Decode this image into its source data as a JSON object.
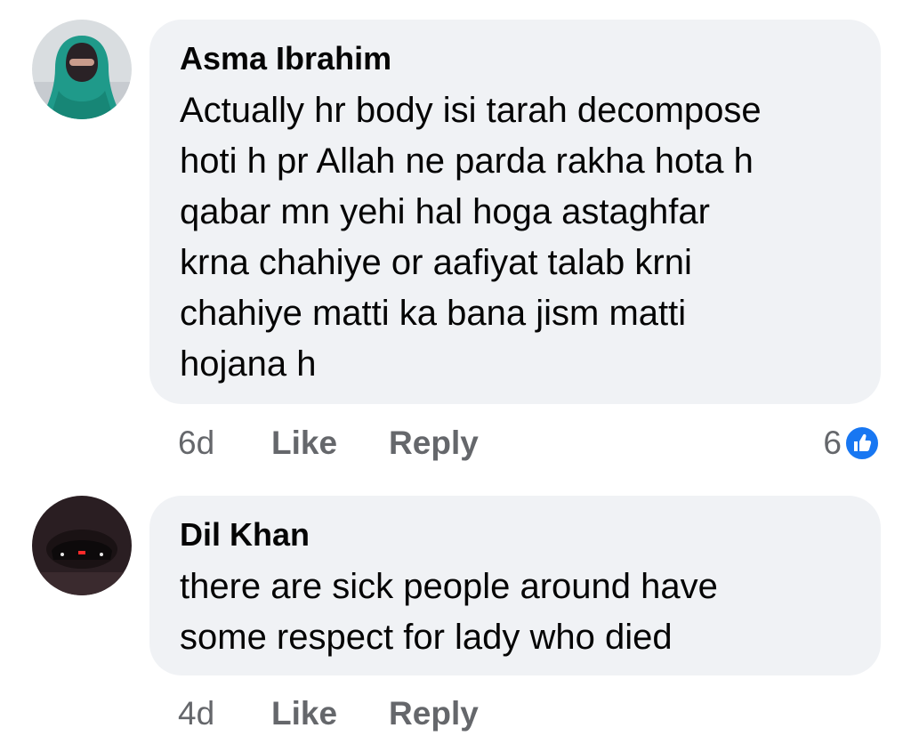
{
  "comments": [
    {
      "author": "Asma Ibrahim",
      "lines": [
        "Actually hr body isi tarah decompose",
        "hoti h pr Allah ne parda rakha hota h",
        "qabar mn yehi hal hoga astaghfar",
        "krna chahiye or aafiyat talab krni",
        "chahiye matti ka bana jism matti",
        "hojana h"
      ],
      "time": "6d",
      "like_label": "Like",
      "reply_label": "Reply",
      "reaction_count": "6"
    },
    {
      "author": "Dil Khan",
      "lines": [
        "there are sick people around have",
        "some respect for lady who died"
      ],
      "time": "4d",
      "like_label": "Like",
      "reply_label": "Reply"
    }
  ],
  "icons": {
    "like_reaction": "thumbs-up-icon"
  },
  "colors": {
    "bubble_bg": "#f0f2f5",
    "meta_text": "#65676b",
    "like_blue": "#1877f2"
  }
}
